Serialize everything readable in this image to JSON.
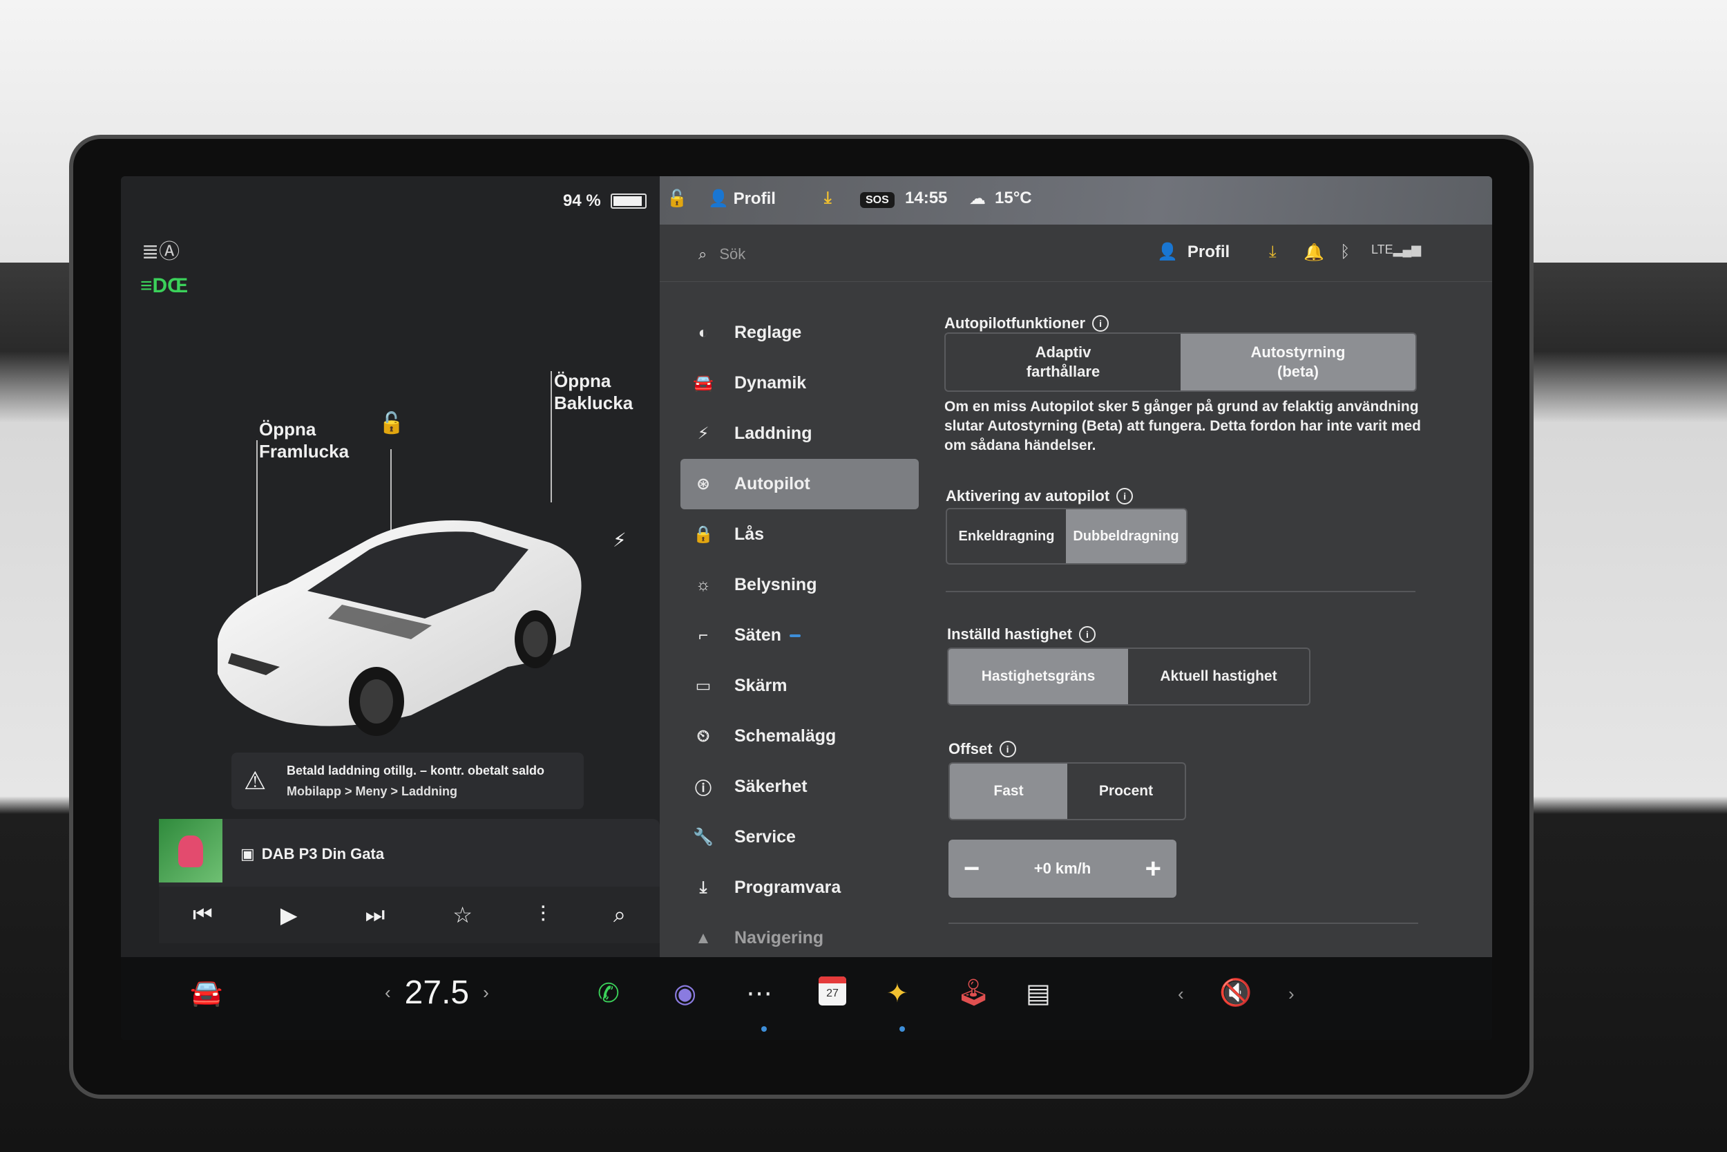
{
  "left": {
    "battery_percent": "94 %",
    "battery_level": 0.94,
    "open_frunk": "Öppna\nFramlucka",
    "open_trunk": "Öppna\nBaklucka",
    "warning_line1": "Betald laddning otillg. – kontr. obetalt saldo",
    "warning_line2": "Mobilapp > Meny > Laddning",
    "media": {
      "station": "DAB P3 Din Gata"
    }
  },
  "statusbar": {
    "profile": "Profil",
    "sos": "SOS",
    "time": "14:55",
    "temperature": "15°C"
  },
  "header": {
    "search_placeholder": "Sök",
    "profile": "Profil"
  },
  "menu": {
    "items": [
      {
        "label": "Reglage",
        "icon": "toggle-icon"
      },
      {
        "label": "Dynamik",
        "icon": "car-icon"
      },
      {
        "label": "Laddning",
        "icon": "bolt-icon"
      },
      {
        "label": "Autopilot",
        "icon": "steering-wheel-icon"
      },
      {
        "label": "Lås",
        "icon": "lock-icon"
      },
      {
        "label": "Belysning",
        "icon": "sun-icon"
      },
      {
        "label": "Säten",
        "icon": "seat-icon"
      },
      {
        "label": "Skärm",
        "icon": "display-icon"
      },
      {
        "label": "Schemalägg",
        "icon": "clock-icon"
      },
      {
        "label": "Säkerhet",
        "icon": "shield-icon"
      },
      {
        "label": "Service",
        "icon": "wrench-icon"
      },
      {
        "label": "Programvara",
        "icon": "download-icon"
      },
      {
        "label": "Navigering",
        "icon": "navigation-icon"
      }
    ],
    "active": "Autopilot"
  },
  "autopilot": {
    "features_title": "Autopilotfunktioner",
    "features_options": [
      "Adaptiv\nfarthållare",
      "Autostyrning\n(beta)"
    ],
    "features_selected": "Autostyrning (beta)",
    "warning_text": "Om en miss Autopilot sker 5 gånger på grund av felaktig användning slutar Autostyrning (Beta) att fungera. Detta fordon har inte varit med om sådana händelser.",
    "activation_title": "Aktivering av autopilot",
    "activation_options": [
      "Enkeldragning",
      "Dubbeldragning"
    ],
    "activation_selected": "Dubbeldragning",
    "speed_title": "Inställd hastighet",
    "speed_options": [
      "Hastighetsgräns",
      "Aktuell hastighet"
    ],
    "speed_selected": "Hastighetsgräns",
    "offset_title": "Offset",
    "offset_options": [
      "Fast",
      "Procent"
    ],
    "offset_selected": "Fast",
    "offset_value": "+0 km/h"
  },
  "dock": {
    "cabin_temp": "27.5",
    "calendar_day": "27"
  }
}
